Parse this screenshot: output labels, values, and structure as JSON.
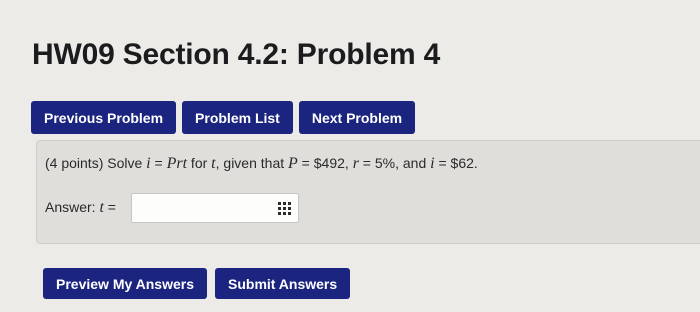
{
  "page": {
    "title": "HW09 Section 4.2: Problem 4"
  },
  "nav": {
    "previous_label": "Previous Problem",
    "list_label": "Problem List",
    "next_label": "Next Problem"
  },
  "problem": {
    "points": "(4 points) Solve",
    "eq_lhs": "i",
    "eq_sign": " = ",
    "eq_rhs": "Prt",
    "for_text": " for ",
    "for_var": "t",
    "given_text": ", given that ",
    "p_var": "P",
    "p_val": " = $492, ",
    "r_var": "r",
    "r_val": " = 5%, and ",
    "i_var": "i",
    "i_val": " = $62."
  },
  "answer": {
    "label_prefix": "Answer: ",
    "label_var": "t",
    "label_suffix": " =",
    "value": "",
    "input_icon": "keypad-icon"
  },
  "actions": {
    "preview_label": "Preview My Answers",
    "submit_label": "Submit Answers"
  },
  "colors": {
    "button": "#1b2580",
    "background": "#ecebe8",
    "problem_box": "#dfdedb"
  }
}
